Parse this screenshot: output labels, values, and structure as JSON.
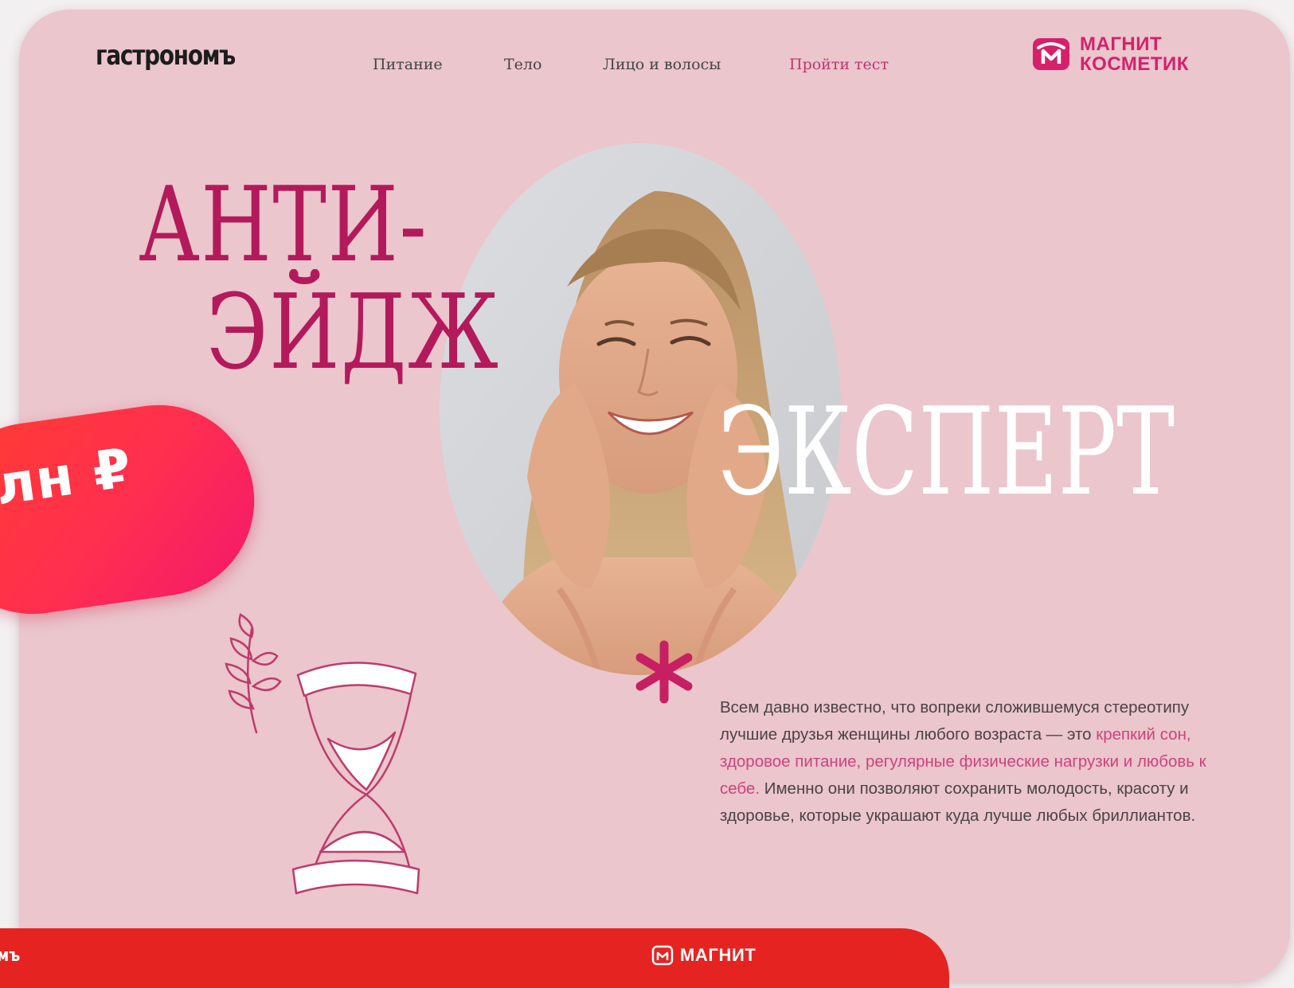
{
  "header": {
    "logo": "гастрономъ",
    "nav": [
      "Питание",
      "Тело",
      "Лицо и волосы",
      "Пройти тест"
    ],
    "brand": {
      "line1": "МАГНИТ",
      "line2": "КОСМЕТИК"
    }
  },
  "hero": {
    "title_line1": "АНТИ-",
    "title_line2": "ЭЙДЖ",
    "title_line3": "ЭКСПЕРТ",
    "description": {
      "p1": "Всем давно известно, что вопреки сложившемуся стереотипу лучшие друзья женщины любого возраста — это ",
      "highlight": "крепкий сон, здоровое питание, регулярные физические нагрузки и любовь к себе.",
      "p2": " Именно они позволяют сохранить молодость, красоту и здоровье, которые украшают куда лучше любых бриллиантов."
    }
  },
  "promo": {
    "text": "лн ₽"
  },
  "footer": {
    "logo_fragment": "мъ",
    "brand": "МАГНИТ"
  },
  "colors": {
    "card_bg": "#ebc6cd",
    "accent": "#b31a5b",
    "brand_pink": "#d6206a",
    "footer_red": "#e52421",
    "promo_gradient": [
      "#ff3d2e",
      "#f3186d"
    ]
  },
  "icons": [
    "magnit-kosmetik-logo-icon",
    "mouse-cursor-icon",
    "branch-leaf-icon",
    "hourglass-icon",
    "asterisk-icon",
    "magnit-logo-icon"
  ]
}
